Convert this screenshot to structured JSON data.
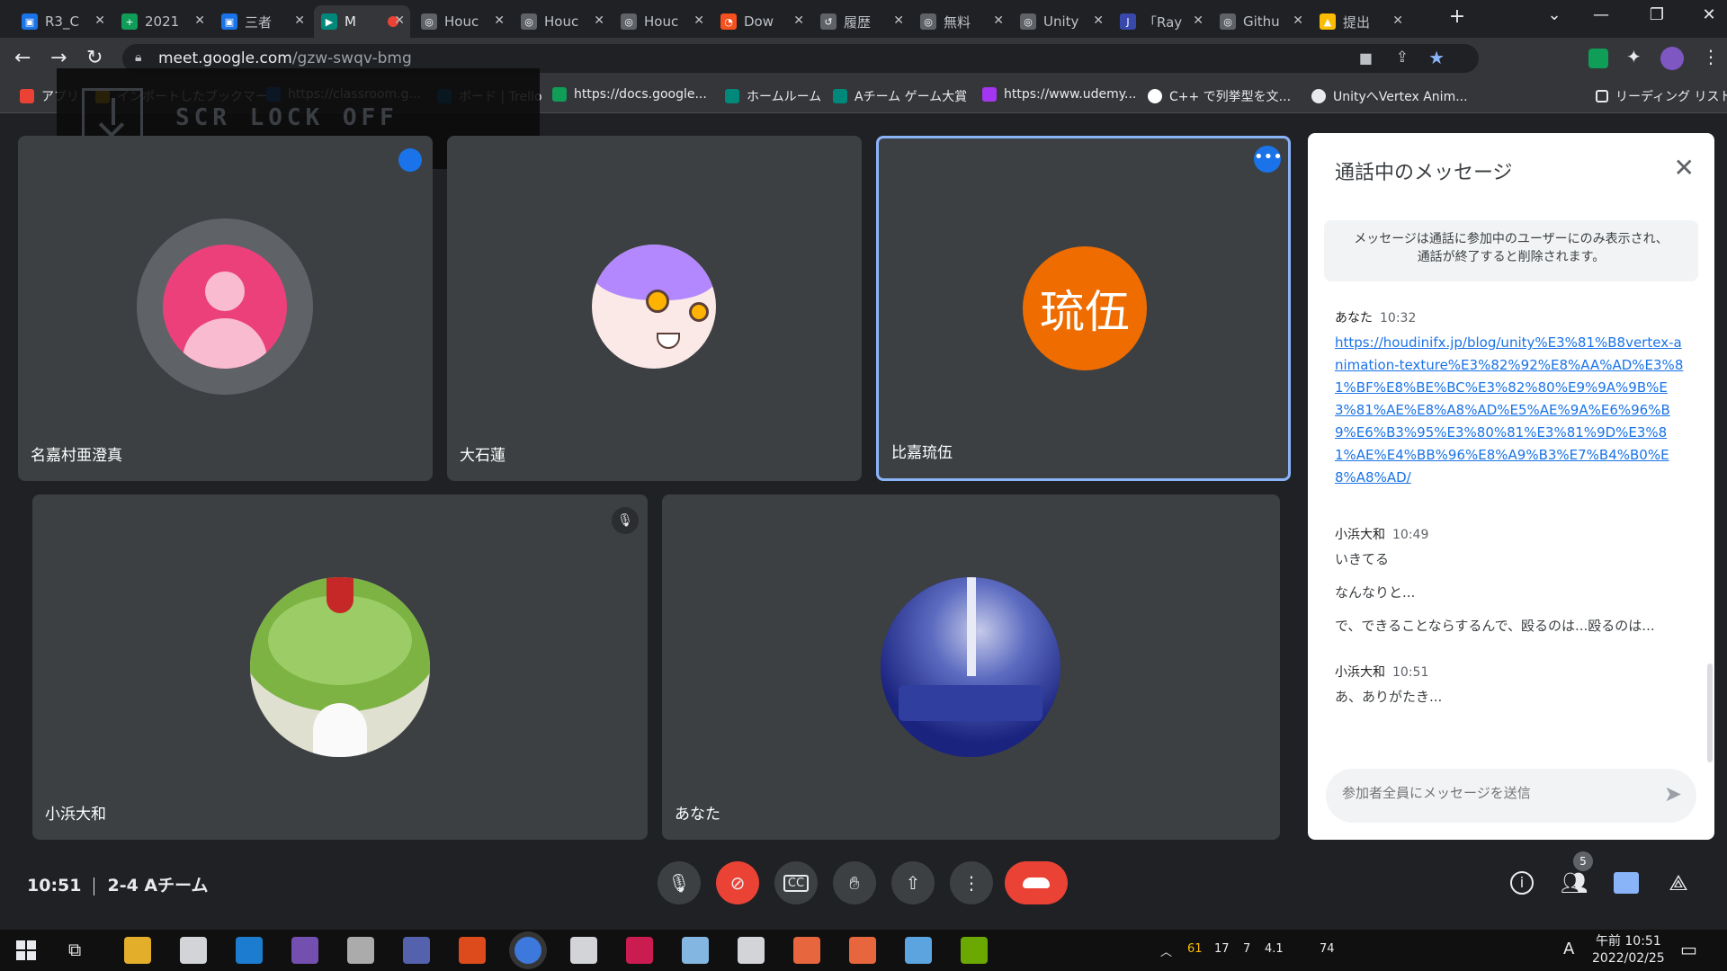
{
  "browser": {
    "tabs": [
      {
        "label": "R3_C",
        "color": "#1a73e8",
        "glyph": "▣"
      },
      {
        "label": "2021",
        "color": "#0f9d58",
        "glyph": "+"
      },
      {
        "label": "三者",
        "color": "#1a73e8",
        "glyph": "▣"
      },
      {
        "label": "M",
        "color": "#00897b",
        "glyph": "▶"
      },
      {
        "label": "Houc",
        "color": "#5f6368",
        "glyph": "◎"
      },
      {
        "label": "Houc",
        "color": "#5f6368",
        "glyph": "◎"
      },
      {
        "label": "Houc",
        "color": "#5f6368",
        "glyph": "◎"
      },
      {
        "label": "Dow",
        "color": "#f4511e",
        "glyph": "◔"
      },
      {
        "label": "履歴",
        "color": "#5f6368",
        "glyph": "↺"
      },
      {
        "label": "無料",
        "color": "#5f6368",
        "glyph": "◎"
      },
      {
        "label": "Unity",
        "color": "#5f6368",
        "glyph": "◎"
      },
      {
        "label": "「Ray",
        "color": "#3949ab",
        "glyph": "J"
      },
      {
        "label": "Githu",
        "color": "#5f6368",
        "glyph": "◎"
      },
      {
        "label": "提出",
        "color": "#fbbc04",
        "glyph": "▲"
      }
    ],
    "url_host": "meet.google.com",
    "url_path": "/gzw-swqv-bmg",
    "bookmarks": [
      {
        "label": "アプリ",
        "color": "#ea4335"
      },
      {
        "label": "インポートしたブックマーク",
        "color": "#fbbc04"
      },
      {
        "label": "https://classroom.g...",
        "color": "#1a73e8"
      },
      {
        "label": "ボード | Trello",
        "color": "#0079bf"
      },
      {
        "label": "https://docs.google...",
        "color": "#0f9d58"
      },
      {
        "label": "ホームルーム",
        "color": "#00897b"
      },
      {
        "label": "Aチーム ゲーム大賞",
        "color": "#00897b"
      },
      {
        "label": "https://www.udemy...",
        "color": "#a435f0"
      },
      {
        "label": "C++ で列挙型を文...",
        "color": "#ffffff"
      },
      {
        "label": "UnityへVertex Anim...",
        "color": "#e8eaed"
      }
    ],
    "reading_list": "リーディング リスト"
  },
  "overlay": {
    "text": "SCR LOCK OFF"
  },
  "participants": [
    {
      "name": "名嘉村亜澄真",
      "avatar": "default-person"
    },
    {
      "name": "大石蓮",
      "avatar": "anime-character"
    },
    {
      "name": "比嘉琉伍",
      "avatar_text": "琉伍",
      "avatar_color": "#ef6c00"
    },
    {
      "name": "小浜大和",
      "avatar": "green-character"
    },
    {
      "name": "あなた",
      "avatar": "concert-stage"
    }
  ],
  "chat": {
    "title": "通話中のメッセージ",
    "notice_line1": "メッセージは通話に参加中のユーザーにのみ表示され、",
    "notice_line2": "通話が終了すると削除されます。",
    "messages": [
      {
        "sender": "あなた",
        "time": "10:32",
        "lines": [
          "https://houdinifx.jp/blog/unity%E3%81%B8vertex-animation-texture%E3%82%92%E8%AA%AD%E3%81%BF%E8%BE%BC%E3%82%80%E9%9A%9B%E3%81%AE%E8%A8%AD%E5%AE%9A%E6%96%B9%E6%B3%95%E3%80%81%E3%81%9D%E3%81%AE%E4%BB%96%E8%A9%B3%E7%B4%B0%E8%A8%AD/"
        ]
      },
      {
        "sender": "小浜大和",
        "time": "10:49",
        "lines": [
          "いきてる",
          "なんなりと...",
          "で、できることならするんで、殴るのは...殴るのは..."
        ]
      },
      {
        "sender": "小浜大和",
        "time": "10:51",
        "lines": [
          "あ、ありがたき..."
        ]
      }
    ],
    "input_placeholder": "参加者全員にメッセージを送信"
  },
  "meeting": {
    "time": "10:51",
    "name": "2-4 Aチーム",
    "participant_count": "5"
  },
  "taskbar": {
    "tray_numbers": [
      "61",
      "17",
      "7",
      "4.1",
      "74"
    ],
    "ime": "A",
    "clock_time": "午前 10:51",
    "clock_date": "2022/02/25"
  }
}
